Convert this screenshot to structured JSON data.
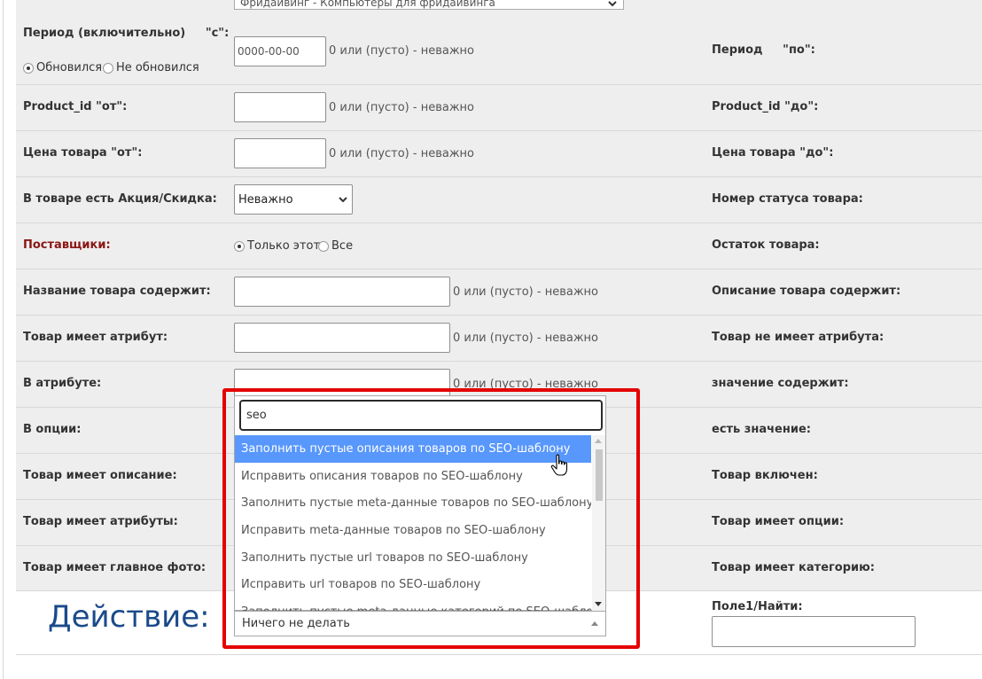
{
  "top_select": {
    "value": "Фридайвинг - Компьютеры для фридайвинга"
  },
  "rows": {
    "period": {
      "label": "Период (включительно)     \"с\":",
      "value": "0000-00-00",
      "hint": "0 или (пусто) - неважно",
      "right_label": "Период     \"по\":",
      "radio_updated": "Обновился",
      "radio_not_updated": "Не обновился"
    },
    "product_id": {
      "label": "Product_id \"от\":",
      "hint": "0 или (пусто) - неважно",
      "right_label": "Product_id \"до\":"
    },
    "price": {
      "label": "Цена товара \"от\":",
      "hint": "0 или (пусто) - неважно",
      "right_label": "Цена товара \"до\":"
    },
    "promo": {
      "label": "В товаре есть Акция/Скидка:",
      "value": "Неважно",
      "right_label": "Номер статуса товара:"
    },
    "suppliers": {
      "label": "Поставщики:",
      "radio_only": "Только этот",
      "radio_all": "Все",
      "right_label": "Остаток товара:"
    },
    "name_contains": {
      "label": "Название товара содержит:",
      "hint": "0 или (пусто) - неважно",
      "right_label": "Описание товара содержит:"
    },
    "has_attribute": {
      "label": "Товар имеет атрибут:",
      "hint": "0 или (пусто) - неважно",
      "right_label": "Товар не имеет атрибута:"
    },
    "in_attribute": {
      "label": "В атрибуте:",
      "hint": "0 или (пусто) - неважно",
      "right_label": "значение содержит:"
    },
    "in_option": {
      "label": "В опции:",
      "right_label": "есть значение:"
    },
    "has_description": {
      "label": "Товар имеет описание:",
      "right_label": "Товар включен:"
    },
    "has_attributes": {
      "label": "Товар имеет атрибуты:",
      "right_label": "Товар имеет опции:"
    },
    "has_main_photo": {
      "label": "Товар имеет главное фото:",
      "right_label": "Товар имеет категорию:"
    }
  },
  "action": {
    "title": "Действие:",
    "search_value": "seo",
    "options": [
      "Заполнить пустые описания товаров по SEO-шаблону",
      "Исправить описания товаров по SEO-шаблону",
      "Заполнить пустые meta-данные товаров по SEO-шаблону",
      "Исправить meta-данные товаров по SEO-шаблону",
      "Заполнить пустые url товаров по SEO-шаблону",
      "Исправить url товаров по SEO-шаблону",
      "Заполнить пустые meta-данные категорий по SEO-шаблону"
    ],
    "highlighted_index": 0,
    "selected_value": "Ничего не делать",
    "field1_label": "Поле1/Найти:"
  },
  "colors": {
    "highlight": "#5897fb",
    "annotation_box": "#e40000",
    "title": "#1a4a8a",
    "supplier_label": "#8b1515"
  }
}
